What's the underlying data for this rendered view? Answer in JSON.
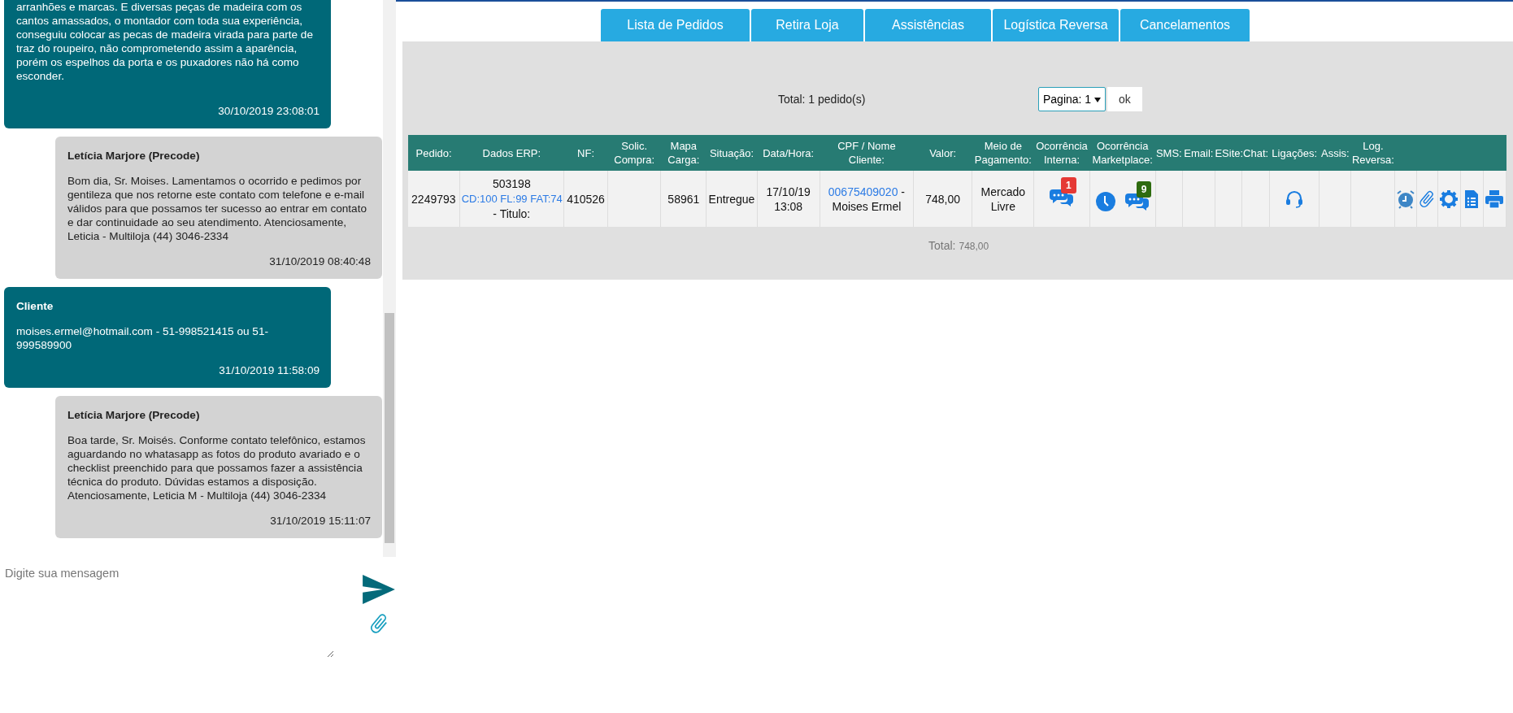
{
  "chat": {
    "messages": [
      {
        "kind": "cliente",
        "text": "arranhões e marcas. E diversas peças de madeira com os cantos amassados, o montador com toda sua experiência, conseguiu colocar as pecas de madeira virada para parte de traz do roupeiro, não comprometendo assim a aparência, porém os espelhos da porta e os puxadores não há como esconder.",
        "time": "30/10/2019 23:08:01"
      },
      {
        "kind": "atendente",
        "author": "Letícia Marjore (Precode)",
        "text": "Bom dia, Sr. Moises. Lamentamos o ocorrido e pedimos por gentileza que nos retorne este contato com telefone e e-mail válidos para que possamos ter sucesso ao entrar em contato e dar continuidade ao seu atendimento. Atenciosamente, Leticia - Multiloja (44) 3046-2334",
        "time": "31/10/2019 08:40:48"
      },
      {
        "kind": "cliente",
        "author": "Cliente",
        "text": "moises.ermel@hotmail.com - 51-998521415 ou 51-999589900",
        "time": "31/10/2019 11:58:09"
      },
      {
        "kind": "atendente",
        "author": "Letícia Marjore (Precode)",
        "text": "Boa tarde, Sr. Moisés. Conforme contato telefônico, estamos aguardando no whatasapp as fotos do produto avariado e o checklist preenchido para que possamos fazer a assistência técnica do produto. Dúvidas estamos a disposição. Atenciosamente, Leticia M - Multiloja (44) 3046-2334",
        "time": "31/10/2019 15:11:07"
      }
    ],
    "input": {
      "placeholder": "Digite sua mensagem"
    }
  },
  "tabs": [
    {
      "label": "Lista de Pedidos",
      "selected": false
    },
    {
      "label": "Retira Loja",
      "selected": false
    },
    {
      "label": "Assistências",
      "selected": false
    },
    {
      "label": "Logística Reversa",
      "selected": false
    },
    {
      "label": "Cancelamentos",
      "selected": false
    }
  ],
  "summary": {
    "total": "Total: 1 pedido(s)",
    "page_select": "Pagina: 1",
    "ok_button": "ok"
  },
  "table": {
    "columns": [
      "Pedido:",
      "Dados ERP:",
      "NF:",
      "Solic. Compra:",
      "Mapa Carga:",
      "Situação:",
      "Data/Hora:",
      "CPF / Nome Cliente:",
      "Valor:",
      "Meio de Pagamento:",
      "Ocorrência Interna:",
      "Ocorrência Marketplace:",
      "SMS:",
      "Email:",
      "ESite:",
      "Chat:",
      "Ligações:",
      "Assis:",
      "Log. Reversa:"
    ],
    "rows": [
      {
        "pedido": "2249793",
        "erp_code": "503198",
        "erp_link": "CD:100 FL:99 FAT:74",
        "erp_suffix": "- Titulo:",
        "nf": "410526",
        "mapa_carga": "58961",
        "situacao": "Entregue",
        "data_hora": "17/10/19 13:08",
        "cpf": "00675409020",
        "cliente": "- Moises Ermel",
        "valor": "748,00",
        "meio_pagamento": "Mercado Livre",
        "ocorrencia_interna": {
          "badge": "1",
          "color": "#e53935"
        },
        "ocorrencia_marketplace": {
          "badge": "9",
          "color": "#2e6b0f"
        }
      }
    ],
    "total_label": "Total:",
    "total_value": "748,00"
  }
}
